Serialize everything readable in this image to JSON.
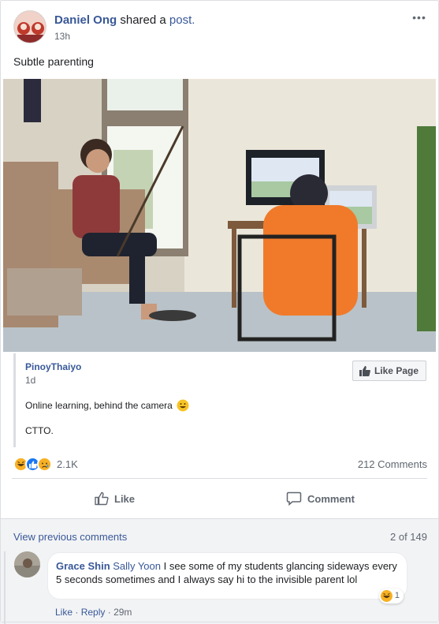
{
  "post": {
    "author": "Daniel Ong",
    "action": "shared a",
    "post_link": "post.",
    "time": "13h",
    "more_icon": "ellipsis-icon",
    "text": "Subtle parenting"
  },
  "shared": {
    "page_name": "PinoyThaiyo",
    "time": "1d",
    "like_page_label": "Like Page",
    "caption": "Online learning, behind the camera",
    "credit": "CTTO."
  },
  "stats": {
    "reaction_icons": [
      "haha-icon",
      "like-icon",
      "sad-icon"
    ],
    "reaction_count": "2.1K",
    "comment_count": "212 Comments"
  },
  "actions": {
    "like_label": "Like",
    "comment_label": "Comment"
  },
  "comments": {
    "view_previous": "View previous comments",
    "pager": "2 of 149",
    "items": [
      {
        "author": "Grace Shin",
        "mention": "Sally Yoon",
        "text": "I see some of my students glancing sideways every 5 seconds sometimes and I always say hi to the invisible parent lol",
        "reaction_count": "1",
        "like": "Like",
        "reply": "Reply",
        "time": "29m"
      }
    ]
  },
  "colors": {
    "link": "#385898",
    "secondary_text": "#606770",
    "like_blue": "#1877f2",
    "haha_yellow": "#f7b125"
  }
}
